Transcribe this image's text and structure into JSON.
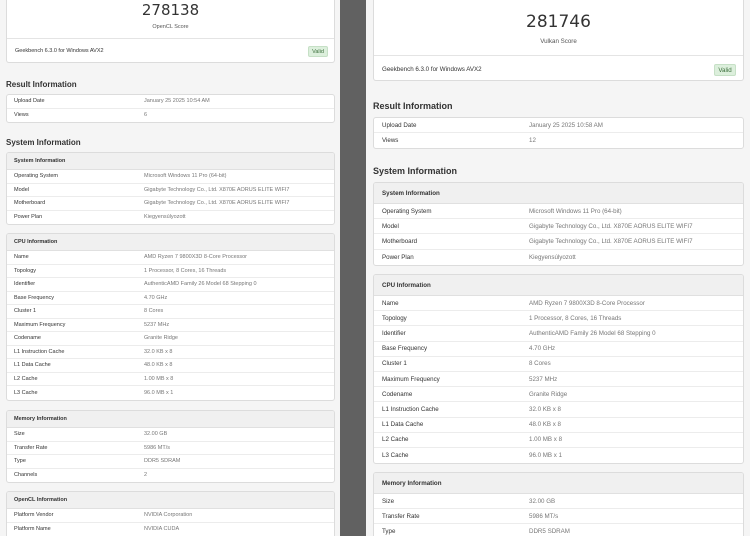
{
  "left": {
    "score": "278138",
    "score_label": "OpenCL Score",
    "version": "Geekbench 6.3.0 for Windows AVX2",
    "valid_badge": "Valid",
    "result_title": "Result Information",
    "result_rows": [
      {
        "k": "Upload Date",
        "v": "January 25 2025 10:54 AM"
      },
      {
        "k": "Views",
        "v": "6"
      }
    ],
    "system_title": "System Information",
    "system_info": {
      "title": "System Information",
      "rows": [
        {
          "k": "Operating System",
          "v": "Microsoft Windows 11 Pro (64-bit)"
        },
        {
          "k": "Model",
          "v": "Gigabyte Technology Co., Ltd. X870E AORUS ELITE WIFI7"
        },
        {
          "k": "Motherboard",
          "v": "Gigabyte Technology Co., Ltd. X870E AORUS ELITE WIFI7"
        },
        {
          "k": "Power Plan",
          "v": "Kiegyensúlyozott"
        }
      ]
    },
    "cpu_info": {
      "title": "CPU Information",
      "rows": [
        {
          "k": "Name",
          "v": "AMD Ryzen 7 9800X3D 8-Core Processor"
        },
        {
          "k": "Topology",
          "v": "1 Processor, 8 Cores, 16 Threads"
        },
        {
          "k": "Identifier",
          "v": "AuthenticAMD Family 26 Model 68 Stepping 0"
        },
        {
          "k": "Base Frequency",
          "v": "4.70 GHz"
        },
        {
          "k": "Cluster 1",
          "v": "8 Cores"
        },
        {
          "k": "Maximum Frequency",
          "v": "5237 MHz"
        },
        {
          "k": "Codename",
          "v": "Granite Ridge"
        },
        {
          "k": "L1 Instruction Cache",
          "v": "32.0 KB x 8"
        },
        {
          "k": "L1 Data Cache",
          "v": "48.0 KB x 8"
        },
        {
          "k": "L2 Cache",
          "v": "1.00 MB x 8"
        },
        {
          "k": "L3 Cache",
          "v": "96.0 MB x 1"
        }
      ]
    },
    "memory_info": {
      "title": "Memory Information",
      "rows": [
        {
          "k": "Size",
          "v": "32.00 GB"
        },
        {
          "k": "Transfer Rate",
          "v": "5986 MT/s"
        },
        {
          "k": "Type",
          "v": "DDR5 SDRAM"
        },
        {
          "k": "Channels",
          "v": "2"
        }
      ]
    },
    "opencl_info": {
      "title": "OpenCL Information",
      "rows": [
        {
          "k": "Platform Vendor",
          "v": "NVIDIA Corporation"
        },
        {
          "k": "Platform Name",
          "v": "NVIDIA CUDA"
        }
      ]
    }
  },
  "right": {
    "score": "281746",
    "score_label": "Vulkan Score",
    "version": "Geekbench 6.3.0 for Windows AVX2",
    "valid_badge": "Valid",
    "result_title": "Result Information",
    "result_rows": [
      {
        "k": "Upload Date",
        "v": "January 25 2025 10:58 AM"
      },
      {
        "k": "Views",
        "v": "12"
      }
    ],
    "system_title": "System Information",
    "system_info": {
      "title": "System Information",
      "rows": [
        {
          "k": "Operating System",
          "v": "Microsoft Windows 11 Pro (64-bit)"
        },
        {
          "k": "Model",
          "v": "Gigabyte Technology Co., Ltd. X870E AORUS ELITE WIFI7"
        },
        {
          "k": "Motherboard",
          "v": "Gigabyte Technology Co., Ltd. X870E AORUS ELITE WIFI7"
        },
        {
          "k": "Power Plan",
          "v": "Kiegyensúlyozott"
        }
      ]
    },
    "cpu_info": {
      "title": "CPU Information",
      "rows": [
        {
          "k": "Name",
          "v": "AMD Ryzen 7 9800X3D 8-Core Processor"
        },
        {
          "k": "Topology",
          "v": "1 Processor, 8 Cores, 16 Threads"
        },
        {
          "k": "Identifier",
          "v": "AuthenticAMD Family 26 Model 68 Stepping 0"
        },
        {
          "k": "Base Frequency",
          "v": "4.70 GHz"
        },
        {
          "k": "Cluster 1",
          "v": "8 Cores"
        },
        {
          "k": "Maximum Frequency",
          "v": "5237 MHz"
        },
        {
          "k": "Codename",
          "v": "Granite Ridge"
        },
        {
          "k": "L1 Instruction Cache",
          "v": "32.0 KB x 8"
        },
        {
          "k": "L1 Data Cache",
          "v": "48.0 KB x 8"
        },
        {
          "k": "L2 Cache",
          "v": "1.00 MB x 8"
        },
        {
          "k": "L3 Cache",
          "v": "96.0 MB x 1"
        }
      ]
    },
    "memory_info": {
      "title": "Memory Information",
      "rows": [
        {
          "k": "Size",
          "v": "32.00 GB"
        },
        {
          "k": "Transfer Rate",
          "v": "5986 MT/s"
        },
        {
          "k": "Type",
          "v": "DDR5 SDRAM"
        }
      ]
    }
  }
}
